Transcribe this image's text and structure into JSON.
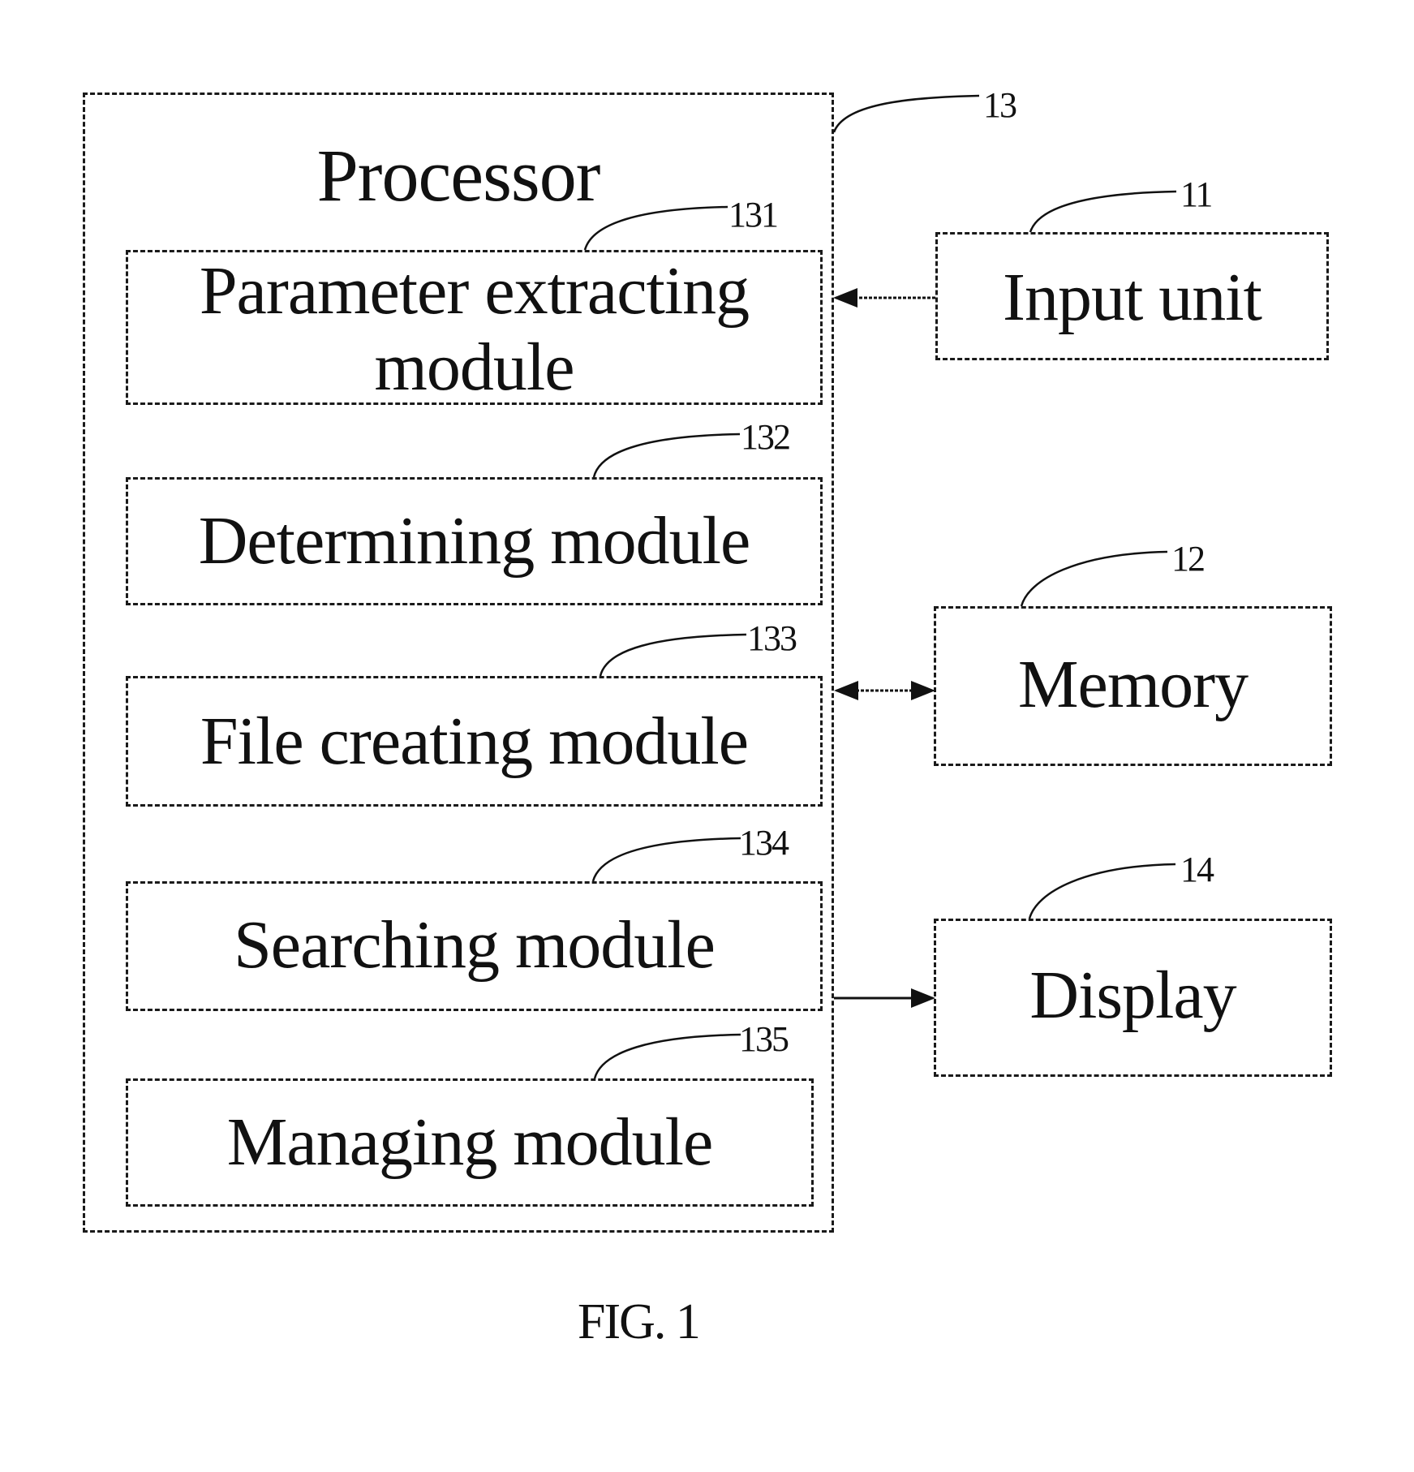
{
  "figure": {
    "caption": "FIG. 1",
    "processor": {
      "label": "Processor",
      "ref": "13"
    },
    "modules": [
      {
        "label_lines": [
          "Parameter extracting",
          "module"
        ],
        "ref": "131"
      },
      {
        "label_lines": [
          "Determining module"
        ],
        "ref": "132"
      },
      {
        "label_lines": [
          "File creating module"
        ],
        "ref": "133"
      },
      {
        "label_lines": [
          "Searching module"
        ],
        "ref": "134"
      },
      {
        "label_lines": [
          "Managing module"
        ],
        "ref": "135"
      }
    ],
    "external_units": [
      {
        "label": "Input unit",
        "ref": "11",
        "connection": "input-to-processor"
      },
      {
        "label": "Memory",
        "ref": "12",
        "connection": "bidirectional"
      },
      {
        "label": "Display",
        "ref": "14",
        "connection": "processor-to-display"
      }
    ]
  }
}
